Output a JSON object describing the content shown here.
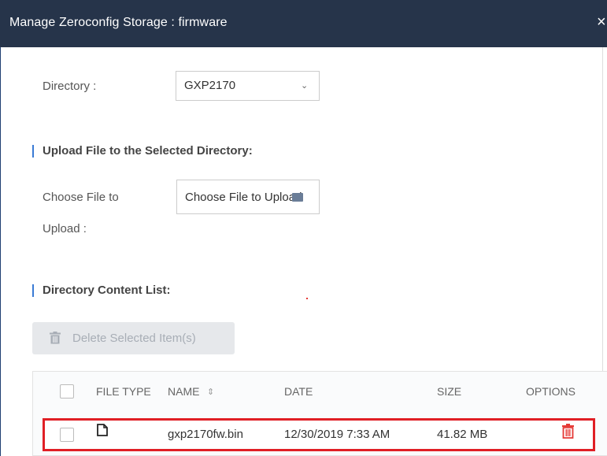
{
  "dialog": {
    "title": "Manage Zeroconfig Storage : firmware",
    "close": "×"
  },
  "directory": {
    "label": "Directory :",
    "selected": "GXP2170",
    "chevron": "⌄"
  },
  "upload": {
    "section_title": "Upload File to the Selected Directory:",
    "label_line1": "Choose File to",
    "label_line2": "Upload :",
    "button_text": "Choose File to Upload"
  },
  "content": {
    "section_title": "Directory Content List:",
    "delete_button": "Delete Selected Item(s)"
  },
  "table": {
    "headers": {
      "file_type": "FILE TYPE",
      "name": "NAME",
      "sort": "⇕",
      "date": "DATE",
      "size": "SIZE",
      "options": "OPTIONS"
    },
    "rows": [
      {
        "name": "gxp2170fw.bin",
        "date": "12/30/2019 7:33 AM",
        "size": "41.82 MB"
      }
    ]
  },
  "colors": {
    "titlebar": "#26344a",
    "accent": "#3a7bd5",
    "highlight": "#e01f25",
    "delete_icon": "#e53935"
  }
}
